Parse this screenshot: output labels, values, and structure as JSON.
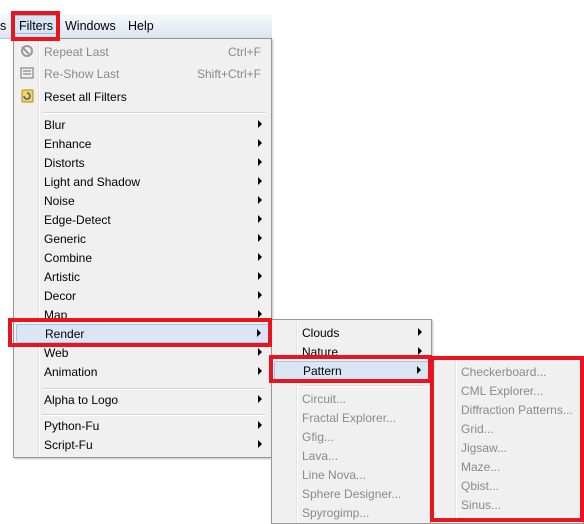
{
  "menubar": {
    "partial_left": "s",
    "filters": "Filters",
    "windows": "Windows",
    "help": "Help"
  },
  "filters_menu": {
    "repeat_last": {
      "label": "Repeat Last",
      "shortcut": "Ctrl+F"
    },
    "reshow_last": {
      "label": "Re-Show Last",
      "shortcut": "Shift+Ctrl+F"
    },
    "reset_all": {
      "label": "Reset all Filters"
    },
    "categories": [
      "Blur",
      "Enhance",
      "Distorts",
      "Light and Shadow",
      "Noise",
      "Edge-Detect",
      "Generic",
      "Combine",
      "Artistic",
      "Decor",
      "Map",
      "Render",
      "Web",
      "Animation"
    ],
    "alpha_to_logo": "Alpha to Logo",
    "fu": [
      "Python-Fu",
      "Script-Fu"
    ]
  },
  "render_menu": {
    "submenus": [
      "Clouds",
      "Nature",
      "Pattern"
    ],
    "items": [
      "Circuit...",
      "Fractal Explorer...",
      "Gfig...",
      "Lava...",
      "Line Nova...",
      "Sphere Designer...",
      "Spyrogimp..."
    ]
  },
  "pattern_menu": {
    "items": [
      "Checkerboard...",
      "CML Explorer...",
      "Diffraction Patterns...",
      "Grid...",
      "Jigsaw...",
      "Maze...",
      "Qbist...",
      "Sinus..."
    ]
  },
  "colors": {
    "highlight_box": "#e8141f",
    "menu_bg": "#f0f0f0",
    "hover_bg": "#dbe6f4",
    "disabled_text": "#8a8a8a"
  }
}
